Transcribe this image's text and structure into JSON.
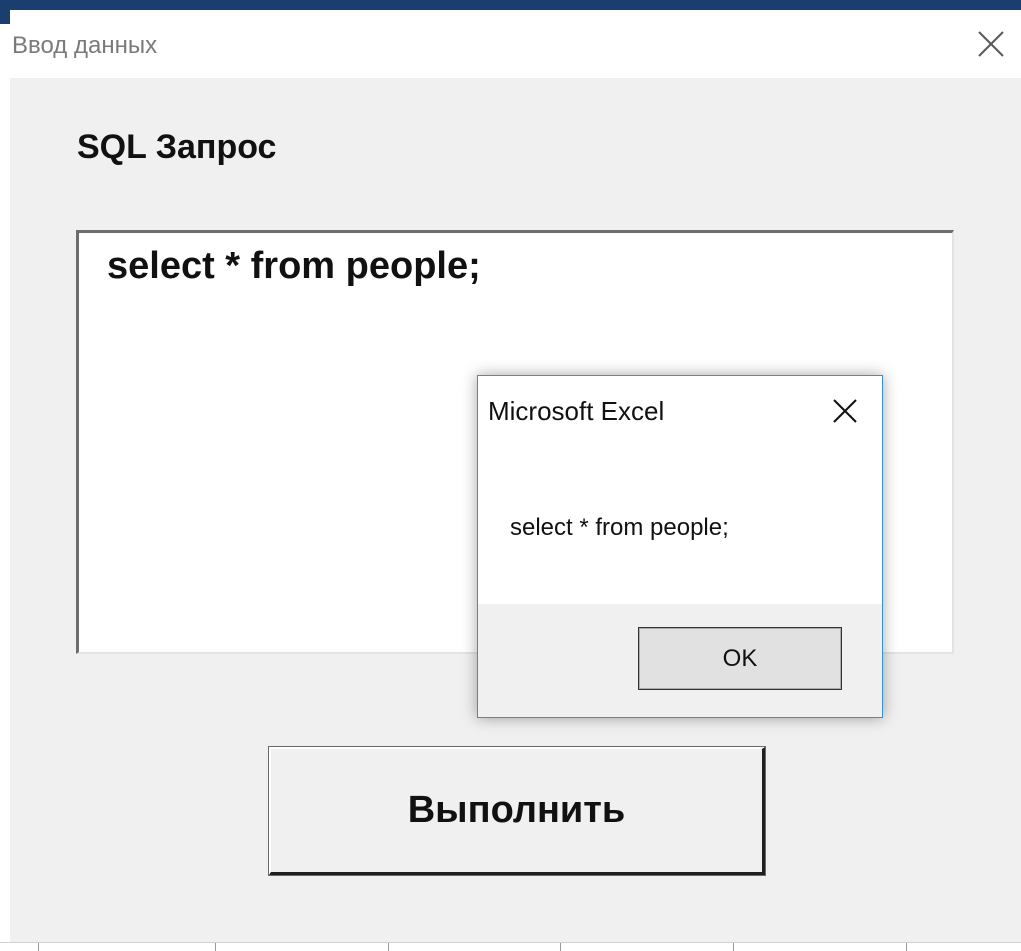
{
  "window": {
    "title": "Ввод данных",
    "close_icon": "close-icon"
  },
  "form": {
    "label": "SQL Запрос",
    "query_value": "select * from people;",
    "execute_button": "Выполнить"
  },
  "msgbox": {
    "title": "Microsoft Excel",
    "message": "select * from people;",
    "ok_button": "OK",
    "close_icon": "close-icon",
    "accent_color": "#3c8fd6"
  },
  "colors": {
    "top_bar": "#1a3f6f",
    "form_background": "#f0f0f0"
  }
}
